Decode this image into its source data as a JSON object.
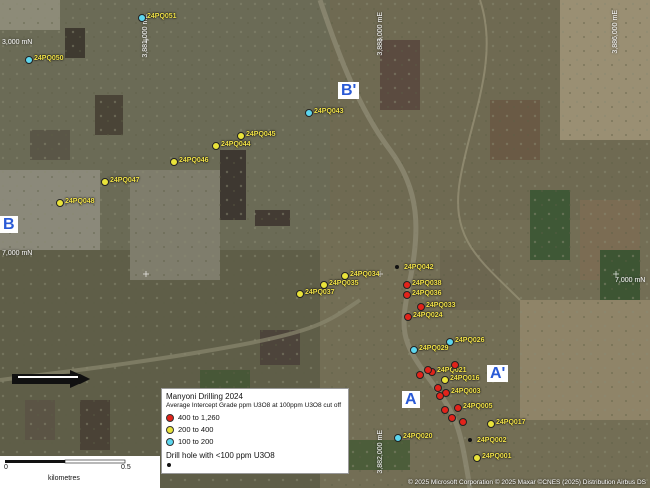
{
  "colors": {
    "high": "#e2231a",
    "mid": "#e9e33a",
    "low": "#5cd6ef",
    "below": "#111111"
  },
  "grid_labels": {
    "n1": "3,000 mN",
    "n2": "7,000 mN",
    "n3": "7,000 mN",
    "e1": "3,881,000 mE",
    "e2": "3,883,000 mE",
    "e3": "3,886,000 mE",
    "e4": "3,882,000 mE"
  },
  "sections": {
    "b": "B",
    "b_prime": "B'",
    "a": "A",
    "a_prime": "A'"
  },
  "drill_holes": [
    {
      "id": "24PQ051",
      "level": "low"
    },
    {
      "id": "24PQ050",
      "level": "low"
    },
    {
      "id": "24PQ043",
      "level": "low"
    },
    {
      "id": "24PQ045",
      "level": "mid"
    },
    {
      "id": "24PQ044",
      "level": "mid"
    },
    {
      "id": "24PQ046",
      "level": "mid"
    },
    {
      "id": "24PQ047",
      "level": "mid"
    },
    {
      "id": "24PQ048",
      "level": "mid"
    },
    {
      "id": "24PQ042",
      "level": "below"
    },
    {
      "id": "24PQ034",
      "level": "mid"
    },
    {
      "id": "24PQ038",
      "level": "high"
    },
    {
      "id": "24PQ035",
      "level": "mid"
    },
    {
      "id": "24PQ036",
      "level": "high"
    },
    {
      "id": "24PQ037",
      "level": "mid"
    },
    {
      "id": "24PQ033",
      "level": "high"
    },
    {
      "id": "24PQ024",
      "level": "high"
    },
    {
      "id": "24PQ026",
      "level": "low"
    },
    {
      "id": "24PQ029",
      "level": "low"
    },
    {
      "id": "24PQ021",
      "level": "high"
    },
    {
      "id": "24PQ016",
      "level": "mid"
    },
    {
      "id": "24PQ003",
      "level": "high"
    },
    {
      "id": "24PQ005",
      "level": "high"
    },
    {
      "id": "24PQ017",
      "level": "mid"
    },
    {
      "id": "24PQ020",
      "level": "low"
    },
    {
      "id": "24PQ002",
      "level": "below"
    },
    {
      "id": "24PQ001",
      "level": "mid"
    }
  ],
  "legend": {
    "title": "Manyoni Drilling 2024",
    "subtitle": "Average Intercept Grade ppm U3O8 at 100ppm U3O8 cut off",
    "items": [
      {
        "label": "400  to  1,260",
        "level": "high"
      },
      {
        "label": "200  to  400",
        "level": "mid"
      },
      {
        "label": "100  to  200",
        "level": "low"
      }
    ],
    "below_label": "Drill hole with <100 ppm U3O8"
  },
  "scale": {
    "ticks": [
      "0",
      "0.5"
    ],
    "unit": "kilometres"
  },
  "copyright": "© 2025 Microsoft Corporation © 2025 Maxar ©CNES (2025) Distribution Airbus DS"
}
